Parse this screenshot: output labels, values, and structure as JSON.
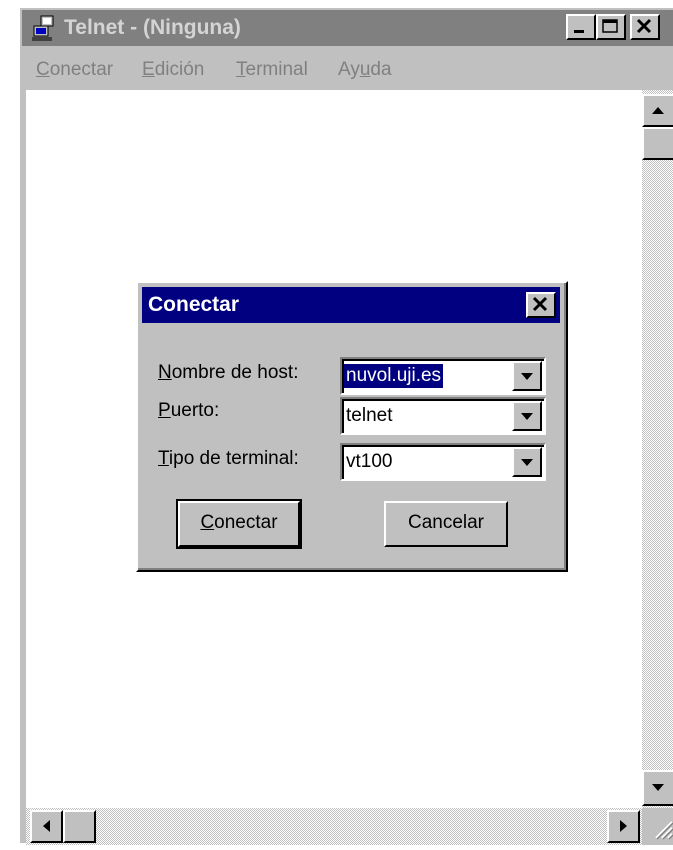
{
  "window": {
    "title": "Telnet - (Ninguna)"
  },
  "menubar": {
    "items": [
      {
        "first": "C",
        "rest": "onectar"
      },
      {
        "first": "E",
        "rest": "dición"
      },
      {
        "first": "T",
        "rest": "erminal"
      },
      {
        "pre": "Ay",
        "first": "u",
        "rest": "da"
      }
    ]
  },
  "dialog": {
    "title": "Conectar",
    "fields": [
      {
        "label_first": "N",
        "label_rest": "ombre de host:",
        "value": "nuvol.uji.es"
      },
      {
        "label_first": "P",
        "label_rest": "uerto:",
        "value": "telnet"
      },
      {
        "label_first": "T",
        "label_rest": "ipo de terminal:",
        "value": "vt100"
      }
    ],
    "connect_first": "C",
    "connect_rest": "onectar",
    "cancel_label": "Cancelar"
  },
  "icons": {
    "app": "telnet-computer-icon",
    "minimize": "minimize-icon",
    "maximize": "maximize-icon",
    "close": "close-icon",
    "dropdown": "chevron-down-icon",
    "scroll_up": "arrow-up-icon",
    "scroll_down": "arrow-down-icon",
    "scroll_left": "arrow-left-icon",
    "scroll_right": "arrow-right-icon",
    "resize_grip": "resize-grip-icon"
  },
  "colors": {
    "inactive_title": "#808080",
    "active_title": "#000080",
    "face": "#c0c0c0",
    "selection": "#000080"
  }
}
